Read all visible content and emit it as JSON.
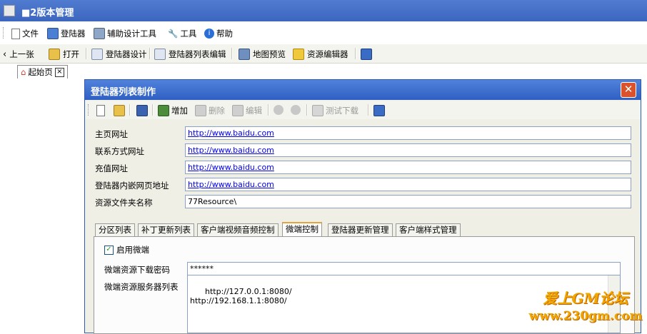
{
  "window": {
    "title": "■2版本管理"
  },
  "menu": {
    "items": [
      {
        "label": "文件",
        "icon": "file-icon"
      },
      {
        "label": "登陆器",
        "icon": "monitor-icon"
      },
      {
        "label": "辅助设计工具",
        "icon": "design-tool-icon"
      },
      {
        "label": "工具",
        "icon": "wrench-icon"
      },
      {
        "label": "帮助",
        "icon": "help-icon"
      }
    ]
  },
  "toolbar": {
    "back": "上一张",
    "open": "打开",
    "launcher_design": "登陆器设计",
    "launcher_list_edit": "登陆器列表编辑",
    "map_preview": "地图预览",
    "resource_editor": "资源编辑器"
  },
  "doc_tab": {
    "label": "起始页",
    "close": "×"
  },
  "dialog": {
    "title": "登陆器列表制作",
    "close": "✕",
    "toolbar": {
      "add": "增加",
      "delete": "删除",
      "edit": "编辑",
      "test_download": "测试下载"
    },
    "fields": [
      {
        "label": "主页网址",
        "value": "http://www.baidu.com",
        "link": true
      },
      {
        "label": "联系方式网址",
        "value": "http://www.baidu.com",
        "link": true
      },
      {
        "label": "充值网址",
        "value": "http://www.baidu.com",
        "link": true
      },
      {
        "label": "登陆器内嵌网页地址",
        "value": "http://www.baidu.com",
        "link": true
      },
      {
        "label": "资源文件夹名称",
        "value": "77Resource\\",
        "link": false
      }
    ],
    "tabs": [
      "分区列表",
      "补丁更新列表",
      "客户端视频音频控制",
      "微端控制",
      "登陆器更新管理",
      "客户端样式管理"
    ],
    "active_tab": "微端控制",
    "micro": {
      "enable_label": "启用微端",
      "enabled": true,
      "password_label": "微端资源下载密码",
      "password_value": "******",
      "servers_label": "微端资源服务器列表",
      "servers_value": "http://127.0.0.1:8080/\nhttp://192.168.1.1:8080/"
    }
  },
  "watermark": {
    "line1": "爱上GM论坛",
    "line2": "www.230gm.com"
  }
}
